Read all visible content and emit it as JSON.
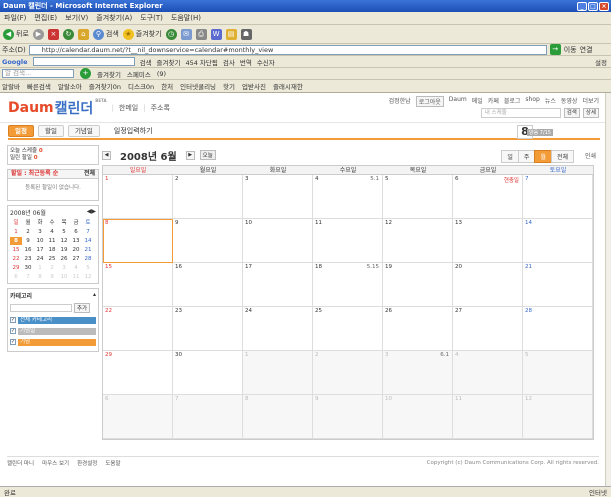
{
  "window": {
    "title": "Daum 캘린더 - Microsoft Internet Explorer"
  },
  "menu": [
    "파일(F)",
    "편집(E)",
    "보기(V)",
    "즐겨찾기(A)",
    "도구(T)",
    "도움말(H)"
  ],
  "toolbar": {
    "back": "뒤로",
    "search": "검색",
    "favorites": "즐겨찾기"
  },
  "address": {
    "label": "주소(D)",
    "url": "http://calendar.daum.net/?t__nil_downservice=calendar#monthly_view",
    "go": "이동",
    "links": "연결"
  },
  "google": {
    "label": "Google",
    "search": "검색",
    "bookmarks": "즐겨찾기",
    "count": "454 차단됨",
    "check": "검사",
    "translate": "번역",
    "send": "수신자",
    "settings": "설정"
  },
  "daumbar": {
    "label": "알 검색...",
    "fav": "즐겨찾기",
    "open": "스페미스",
    "count": "(9)"
  },
  "linksbar": [
    "알랄바",
    "빠른검색",
    "알랄소아",
    "즐겨찾기0n",
    "디스크0n",
    "한처",
    "인터넷쿨리닝",
    "핫기",
    "업받사진",
    "즐래시재한"
  ],
  "calendar": {
    "logo_d": "Daum",
    "logo_text": "캘린더",
    "beta": "BETA",
    "nav1": "한메일",
    "nav2": "주소록",
    "topnav": [
      "검정한남",
      "로그아웃",
      "Daum",
      "메일",
      "카페",
      "블로그",
      "shop",
      "뉴스",
      "동영상",
      "더보기"
    ],
    "search_placeholder": "내 스케줄",
    "search_btn": "검색",
    "detail_btn": "상세",
    "tabs": [
      "일정",
      "할일",
      "기념일"
    ],
    "add_memo": "일정입력하기",
    "today_num": "8",
    "lunar": "양음 7/15",
    "arrow": "",
    "side": {
      "today_count": "오늘 스케줄",
      "today_num": "0",
      "todo_count": "밀린 할일",
      "todo_num": "0",
      "todo_head": "할일 : 최근등록 순",
      "todo_more": "전체",
      "todo_empty": "등록된 할일이 없습니다.",
      "mini_title": "2008년",
      "mini_month": "06월",
      "mini_dow": [
        "일",
        "월",
        "화",
        "수",
        "목",
        "금",
        "토"
      ],
      "cat_title": "카테고리",
      "cat_btn": "추가",
      "cats": [
        {
          "label": "전체 카테고리",
          "color": "#4a90c8"
        },
        {
          "label": "기념일",
          "color": "#bbbbbb"
        },
        {
          "label": "기념",
          "color": "#f29b37"
        }
      ]
    },
    "main": {
      "title": "2008년 6월",
      "today_btn": "오늘",
      "views": [
        "일",
        "주",
        "월",
        "전체"
      ],
      "print": "인쇄",
      "dow": [
        "일요일",
        "월요일",
        "화요일",
        "수요일",
        "목요일",
        "금요일",
        "토요일"
      ]
    },
    "weeks": [
      [
        {
          "n": "1"
        },
        {
          "n": "2"
        },
        {
          "n": "3"
        },
        {
          "n": "4",
          "lunar": "5.1"
        },
        {
          "n": "5"
        },
        {
          "n": "6",
          "holiday": "현충일"
        },
        {
          "n": "7"
        }
      ],
      [
        {
          "n": "8",
          "today": true
        },
        {
          "n": "9"
        },
        {
          "n": "10"
        },
        {
          "n": "11"
        },
        {
          "n": "12"
        },
        {
          "n": "13"
        },
        {
          "n": "14"
        }
      ],
      [
        {
          "n": "15"
        },
        {
          "n": "16"
        },
        {
          "n": "17"
        },
        {
          "n": "18",
          "lunar": "5.15"
        },
        {
          "n": "19"
        },
        {
          "n": "20"
        },
        {
          "n": "21"
        }
      ],
      [
        {
          "n": "22"
        },
        {
          "n": "23"
        },
        {
          "n": "24"
        },
        {
          "n": "25"
        },
        {
          "n": "26"
        },
        {
          "n": "27"
        },
        {
          "n": "28"
        }
      ],
      [
        {
          "n": "29"
        },
        {
          "n": "30"
        },
        {
          "n": "1",
          "dim": true
        },
        {
          "n": "2",
          "dim": true
        },
        {
          "n": "3",
          "dim": true,
          "lunar": "6.1"
        },
        {
          "n": "4",
          "dim": true
        },
        {
          "n": "5",
          "dim": true
        }
      ],
      [
        {
          "n": "6",
          "dim": true
        },
        {
          "n": "7",
          "dim": true
        },
        {
          "n": "8",
          "dim": true
        },
        {
          "n": "9",
          "dim": true
        },
        {
          "n": "10",
          "dim": true
        },
        {
          "n": "11",
          "dim": true
        },
        {
          "n": "12",
          "dim": true
        }
      ]
    ],
    "footer": {
      "links": [
        "캘린더 마니",
        "마우스 보기",
        "환경설정",
        "도움말"
      ],
      "copyright": "Copyright (c) Daum Communications Corp. All rights reserved."
    }
  },
  "status": {
    "left": "완료",
    "zone": "인터넷"
  }
}
